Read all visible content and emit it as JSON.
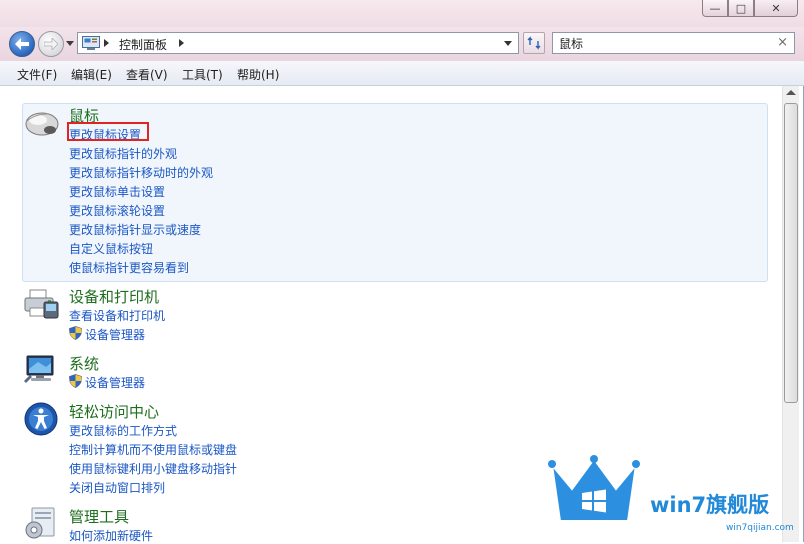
{
  "window": {
    "buttons": {
      "minimize": "—",
      "maximize": "□",
      "close": "✕"
    }
  },
  "address": {
    "breadcrumb": "控制面板",
    "refresh_icon": "refresh-icon"
  },
  "search": {
    "value": "鼠标",
    "clear_glyph": "×"
  },
  "menu": {
    "items": [
      "文件(F)",
      "编辑(E)",
      "查看(V)",
      "工具(T)",
      "帮助(H)"
    ]
  },
  "results": {
    "mouse": {
      "title": "鼠标",
      "tasks": [
        "更改鼠标设置",
        "更改鼠标指针的外观",
        "更改鼠标指针移动时的外观",
        "更改鼠标单击设置",
        "更改鼠标滚轮设置",
        "更改鼠标指针显示或速度",
        "自定义鼠标按钮",
        "使鼠标指针更容易看到"
      ]
    },
    "devices": {
      "title": "设备和打印机",
      "tasks": [
        "查看设备和打印机"
      ],
      "shield_task": "设备管理器"
    },
    "system": {
      "title": "系统",
      "shield_task": "设备管理器"
    },
    "ease": {
      "title": "轻松访问中心",
      "tasks": [
        "更改鼠标的工作方式",
        "控制计算机而不使用鼠标或键盘",
        "使用鼠标键利用小键盘移动指针",
        "关闭自动窗口排列"
      ]
    },
    "admin": {
      "title": "管理工具",
      "tasks": [
        "如何添加新硬件"
      ]
    }
  },
  "watermark": {
    "brand": "win7旗舰版",
    "url": "win7qijian.com"
  },
  "colors": {
    "link": "#1b57c4",
    "group_title": "#1e6e1e",
    "highlight_bg": "#f1f6fc",
    "focus_outline": "#e02424",
    "watermark": "#2189d8"
  }
}
